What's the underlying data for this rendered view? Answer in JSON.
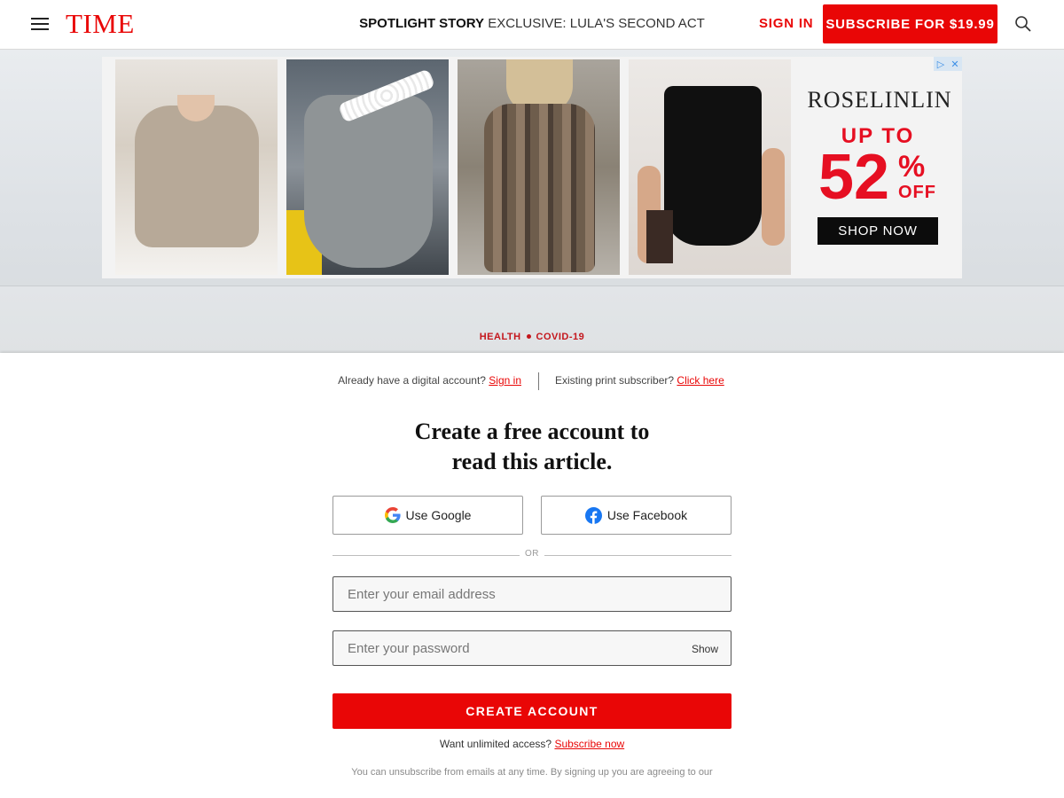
{
  "header": {
    "logo": "TIME",
    "spotlight_label": "SPOTLIGHT STORY",
    "spotlight_headline": "EXCLUSIVE: LULA'S SECOND ACT",
    "sign_in": "SIGN IN",
    "subscribe": "SUBSCRIBE FOR $19.99",
    "brand_color": "#e90606"
  },
  "ad": {
    "brand": "ROSELINLIN",
    "up_to": "UP TO",
    "discount_number": "52",
    "percent": "%",
    "off": "OFF",
    "cta": "SHOP NOW",
    "adchoices_icons": [
      "adchoices-triangle-icon",
      "close-icon"
    ]
  },
  "article": {
    "category_1": "HEALTH",
    "category_2": "COVID-19"
  },
  "modal": {
    "existing_digital_prompt": "Already have a digital account?",
    "sign_in_link": "Sign in",
    "print_prompt": "Existing print subscriber?",
    "click_here_link": "Click here",
    "title_line1": "Create a free account to",
    "title_line2": "read this article.",
    "google_label": "Use Google",
    "facebook_label": "Use Facebook",
    "or_label": "OR",
    "email_placeholder": "Enter your email address",
    "password_placeholder": "Enter your password",
    "show_label": "Show",
    "create_label": "CREATE ACCOUNT",
    "unlimited_prompt": "Want unlimited access?",
    "subscribe_now_link": "Subscribe now",
    "legal_text": "You can unsubscribe from emails at any time. By signing up you are agreeing to our"
  }
}
